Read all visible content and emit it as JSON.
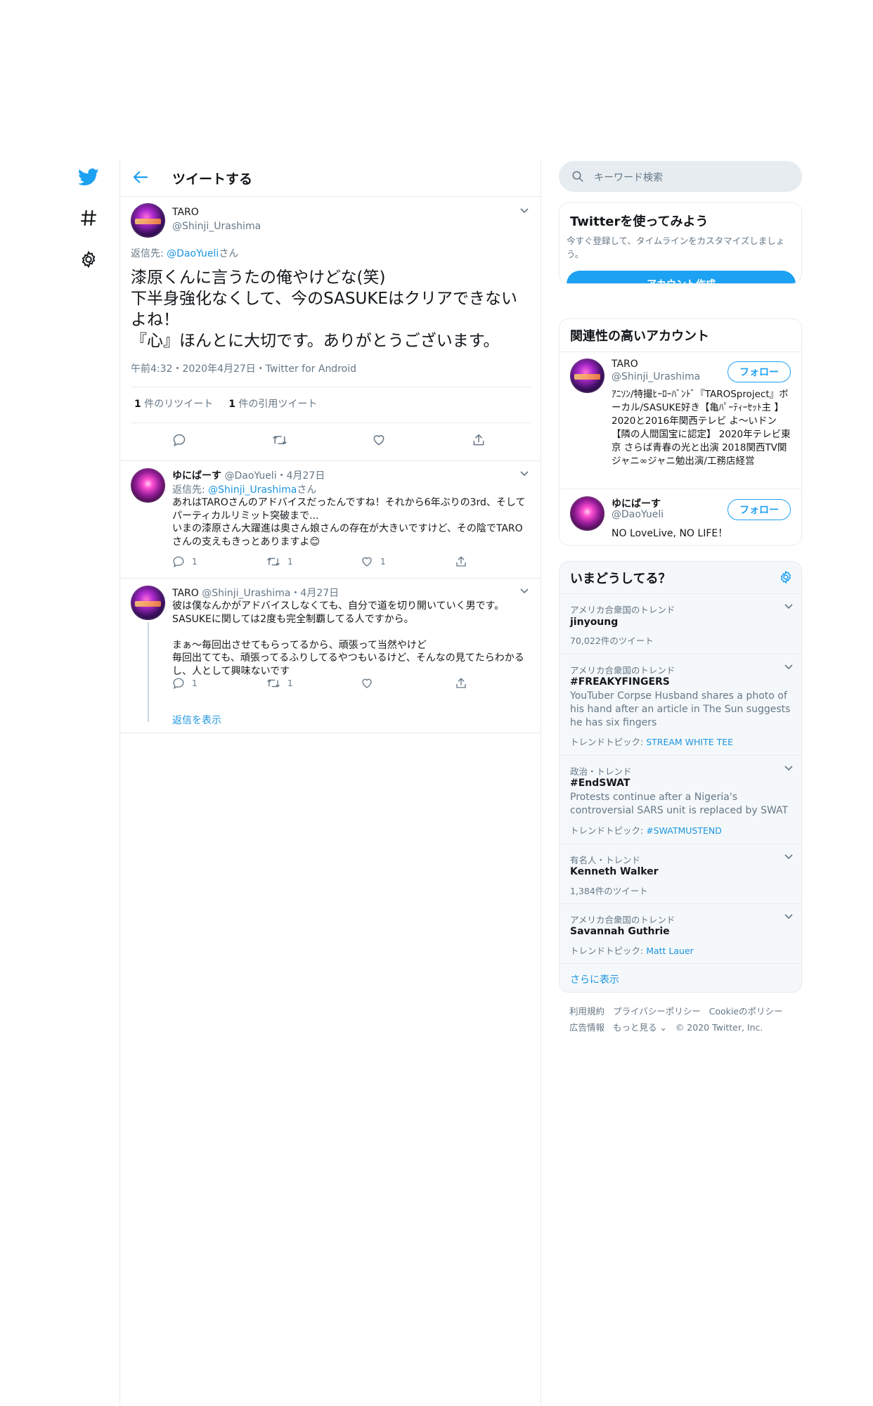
{
  "header": {
    "title": "ツイートする"
  },
  "focus": {
    "name": "TARO",
    "handle": "@Shinji_Urashima",
    "reply_prefix": "返信先: ",
    "reply_handle": "@DaoYueli",
    "reply_suffix": "さん",
    "text": "漆原くんに言うたの俺やけどな(笑)\n下半身強化なくして、今のSASUKEはクリアできないよね！\n『心』ほんとに大切です。ありがとうございます。",
    "meta": "午前4:32・2020年4月27日・Twitter for Android",
    "retweets_count": "1",
    "retweets_label": " 件のリツイート",
    "quotes_count": "1",
    "quotes_label": " 件の引用ツイート"
  },
  "replies": [
    {
      "name": "ゆにばーす",
      "handle": "@DaoYueli",
      "date": "・4月27日",
      "reply_prefix": "返信先: ",
      "reply_handle": "@Shinji_Urashima",
      "reply_suffix": "さん",
      "text": "あれはTAROさんのアドバイスだったんですね！それから6年ぶりの3rd、そしてパーティカルリミット突破まで...\nいまの漆原さん大躍進は奥さん娘さんの存在が大きいですけど、その陰でTAROさんの支えもきっとありますよ😊",
      "reply_count": "1",
      "retweet_count": "1",
      "like_count": "1"
    },
    {
      "name": "TARO",
      "handle": "@Shinji_Urashima",
      "date": "・4月27日",
      "text": "彼は僕なんかがアドバイスしなくても、自分で道を切り開いていく男です。SASUKEに関しては2度も完全制覇してる人ですから。\n\nまぁ～毎回出させてもらってるから、頑張って当然やけど\n毎回出てても、頑張ってるふりしてるやつもいるけど、そんなの見てたらわかるし、人として興味ないです",
      "reply_count": "1",
      "retweet_count": "1",
      "like_count": ""
    }
  ],
  "show_replies": "返信を表示",
  "search": {
    "placeholder": "キーワード検索"
  },
  "signup": {
    "title": "Twitterを使ってみよう",
    "desc": "今すぐ登録して、タイムラインをカスタマイズしましょう。",
    "button": "アカウント作成"
  },
  "related": {
    "title": "関連性の高いアカウント",
    "follow_label": "フォロー",
    "accounts": [
      {
        "name": "TARO",
        "handle": "@Shinji_Urashima",
        "bio": "ｱﾆｿﾝ/特撮ﾋｰﾛｰﾊﾞﾝﾄﾞ『TAROSproject』ボーカル/SASUKE好き【亀ﾊﾟｰﾃｨｰｾｯﾄ主 】 2020と2016年関西テレビ よ～いドン 【隣の人間国宝に認定】 2020年テレビ東京 さらば青春の光と出演 2018関西TV関ジャニ∞ジャニ勉出演/工務店経営"
      },
      {
        "name": "ゆにばーす",
        "handle": "@DaoYueli",
        "bio": "NO LoveLive, NO LIFE！"
      }
    ]
  },
  "trends": {
    "title": "いまどうしてる？",
    "items": [
      {
        "context": "アメリカ合衆国のトレンド",
        "name": "jinyoung",
        "sub": "70,022件のツイート"
      },
      {
        "context": "アメリカ合衆国のトレンド",
        "name": "#FREAKYFINGERS",
        "desc": "YouTuber Corpse Husband shares a photo of his hand after an article in The Sun suggests he has six fingers",
        "topic_label": "トレンドトピック: ",
        "topic": "STREAM WHITE TEE"
      },
      {
        "context": "政治・トレンド",
        "name": "#EndSWAT",
        "desc": "Protests continue after a Nigeria's controversial SARS unit is replaced by SWAT",
        "topic_label": "トレンドトピック: ",
        "topic": "#SWATMUSTEND"
      },
      {
        "context": "有名人・トレンド",
        "name": "Kenneth Walker",
        "sub": "1,384件のツイート"
      },
      {
        "context": "アメリカ合衆国のトレンド",
        "name": "Savannah Guthrie",
        "topic_label": "トレンドトピック: ",
        "topic": "Matt Lauer"
      }
    ],
    "more": "さらに表示"
  },
  "footer": {
    "line1": [
      "利用規約",
      "プライバシーポリシー",
      "Cookieのポリシー"
    ],
    "line2": [
      "広告情報",
      "もっと見る",
      "© 2020 Twitter, Inc."
    ]
  },
  "colors": {
    "accent": "#1da1f2",
    "link": "#1b95e0",
    "muted": "#657786",
    "border": "#e6ecf0"
  }
}
